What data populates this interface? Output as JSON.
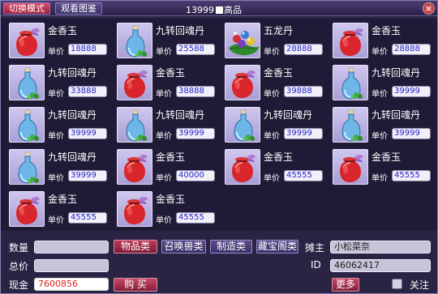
{
  "titlebar": {
    "switch_mode": "切换模式",
    "view_catalog": "观看图鉴",
    "server_prefix": "13999",
    "server_suffix": "高品",
    "close_glyph": "×"
  },
  "price_label": "单价",
  "items": [
    {
      "name": "金香玉",
      "price": "18888",
      "icon": "red-pouch-icon"
    },
    {
      "name": "九转回魂丹",
      "price": "25588",
      "icon": "blue-bottle-icon"
    },
    {
      "name": "五龙丹",
      "price": "28888",
      "icon": "five-dragon-pill-icon"
    },
    {
      "name": "金香玉",
      "price": "28888",
      "icon": "red-pouch-icon"
    },
    {
      "name": "九转回魂丹",
      "price": "33888",
      "icon": "blue-bottle-icon"
    },
    {
      "name": "金香玉",
      "price": "38888",
      "icon": "red-pouch-icon"
    },
    {
      "name": "金香玉",
      "price": "39888",
      "icon": "red-pouch-icon"
    },
    {
      "name": "九转回魂丹",
      "price": "39999",
      "icon": "blue-bottle-icon"
    },
    {
      "name": "九转回魂丹",
      "price": "39999",
      "icon": "blue-bottle-icon"
    },
    {
      "name": "九转回魂丹",
      "price": "39999",
      "icon": "blue-bottle-icon"
    },
    {
      "name": "九转回魂丹",
      "price": "39999",
      "icon": "blue-bottle-icon"
    },
    {
      "name": "九转回魂丹",
      "price": "39999",
      "icon": "blue-bottle-icon"
    },
    {
      "name": "九转回魂丹",
      "price": "39999",
      "icon": "blue-bottle-icon"
    },
    {
      "name": "金香玉",
      "price": "40000",
      "icon": "red-pouch-icon"
    },
    {
      "name": "金香玉",
      "price": "45555",
      "icon": "red-pouch-icon"
    },
    {
      "name": "金香玉",
      "price": "45555",
      "icon": "red-pouch-icon"
    },
    {
      "name": "金香玉",
      "price": "45555",
      "icon": "red-pouch-icon"
    },
    {
      "name": "金香玉",
      "price": "45555",
      "icon": "red-pouch-icon"
    }
  ],
  "bottom": {
    "quantity_label": "数量",
    "total_label": "总价",
    "cash_label": "现金",
    "cash_value": "7600856",
    "buy_label": "购 买",
    "categories": [
      "物品类",
      "召唤兽类",
      "制造类",
      "藏宝阁类"
    ],
    "owner_label": "摊主",
    "owner_value": "小松菜奈",
    "id_label": "ID",
    "id_value": "46062417",
    "more_label": "更多",
    "follow_label": "关注"
  },
  "colors": {
    "background": "#2b2344",
    "accent_red": "#b93a5a",
    "price_text": "#2323c8",
    "cash_text": "#e02020"
  }
}
